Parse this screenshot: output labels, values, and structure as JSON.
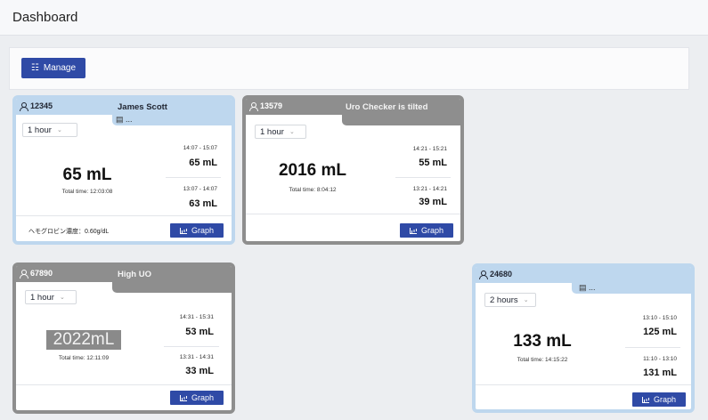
{
  "header": {
    "title": "Dashboard"
  },
  "toolbar": {
    "manage_label": "Manage",
    "manage_icon": "users-icon"
  },
  "cards": [
    {
      "id": "12345",
      "name": "James Scott",
      "note": "...",
      "alert": "",
      "period": "1 hour",
      "total_ml": "65 mL",
      "total_time": "Total time: 12:03:08",
      "recent": [
        {
          "range": "14:07 - 15:07",
          "value": "65 mL"
        },
        {
          "range": "13:07 - 14:07",
          "value": "63 mL"
        }
      ],
      "hemoglobin": "ヘモグロビン濃度：0.60g/dL",
      "graph_label": "Graph",
      "style": "blue"
    },
    {
      "id": "13579",
      "name": "",
      "note": "",
      "alert": "Uro Checker is tilted",
      "period": "1 hour",
      "total_ml": "2016 mL",
      "total_time": "Total time: 8:04:12",
      "recent": [
        {
          "range": "14:21 - 15:21",
          "value": "55 mL"
        },
        {
          "range": "13:21 - 14:21",
          "value": "39 mL"
        }
      ],
      "graph_label": "Graph",
      "style": "gray"
    },
    {
      "id": "67890",
      "name": "",
      "note": "",
      "alert": "High UO",
      "period": "1 hour",
      "total_ml": "2022mL",
      "total_time": "Total time: 12:11:09",
      "recent": [
        {
          "range": "14:31 - 15:31",
          "value": "53 mL"
        },
        {
          "range": "13:31 - 14:31",
          "value": "33 mL"
        }
      ],
      "graph_label": "Graph",
      "style": "gray"
    },
    {
      "id": "24680",
      "name": "",
      "note": "...",
      "alert": "",
      "period": "2 hours",
      "total_ml": "133 mL",
      "total_time": "Total time: 14:15:22",
      "recent": [
        {
          "range": "13:10 - 15:10",
          "value": "125 mL"
        },
        {
          "range": "11:10 - 13:10",
          "value": "131 mL"
        }
      ],
      "graph_label": "Graph",
      "style": "blue"
    }
  ],
  "colors": {
    "accent": "#2f4aa6",
    "card_normal": "#bed7ee",
    "card_alert": "#8e8e8e",
    "background": "#eceef1"
  }
}
